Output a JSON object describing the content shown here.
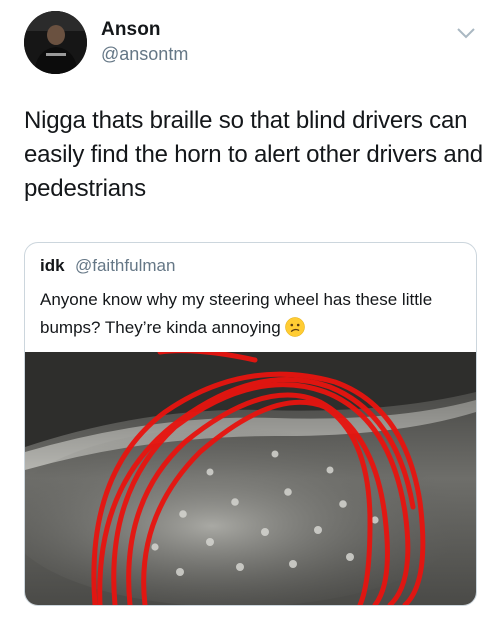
{
  "tweet": {
    "author_name": "Anson",
    "author_handle": "@ansontm",
    "text": "Nigga thats braille so that blind drivers can easily find the horn to alert other drivers and pedestrians"
  },
  "quoted_tweet": {
    "author_name": "idk",
    "author_handle": "@faithfulman",
    "text": "Anyone know why my steering wheel has these little bumps? They’re kinda annoying",
    "emoji": "confused-face"
  },
  "icons": {
    "menu": "chevron-down-icon",
    "emoji": "confused-face-icon"
  },
  "colors": {
    "text": "#14171a",
    "secondary_text": "#657786",
    "border": "#ccd6dd",
    "annotation_red": "#e8140f"
  }
}
